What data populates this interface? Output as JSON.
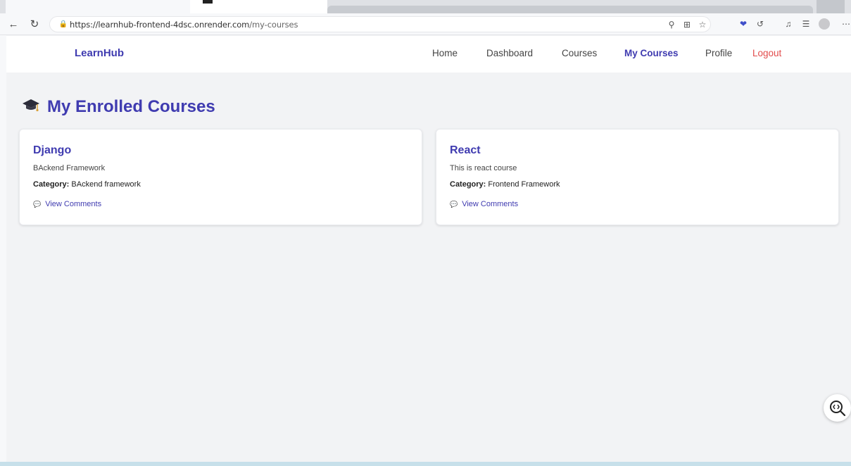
{
  "browser": {
    "url_host": "https://learnhub-frontend-4dsc.onrender.com",
    "url_path": "/my-courses"
  },
  "header": {
    "brand": "LearnHub",
    "nav": [
      {
        "label": "Home"
      },
      {
        "label": "Dashboard"
      },
      {
        "label": "Courses"
      },
      {
        "label": "My Courses",
        "active": true
      },
      {
        "label": "Profile"
      },
      {
        "label": "Logout"
      }
    ]
  },
  "page": {
    "title": "My Enrolled Courses",
    "title_icon": "graduation-cap-icon"
  },
  "courses": [
    {
      "title": "Django",
      "description": "BAckend Framework",
      "category_label": "Category:",
      "category": "BAckend framework",
      "comments_link": "View Comments"
    },
    {
      "title": "React",
      "description": "This is react course",
      "category_label": "Category:",
      "category": "Frontend Framework",
      "comments_link": "View Comments"
    }
  ],
  "colors": {
    "accent": "#3f3bb0",
    "logout": "#e24b4b",
    "background": "#f2f3f5"
  }
}
